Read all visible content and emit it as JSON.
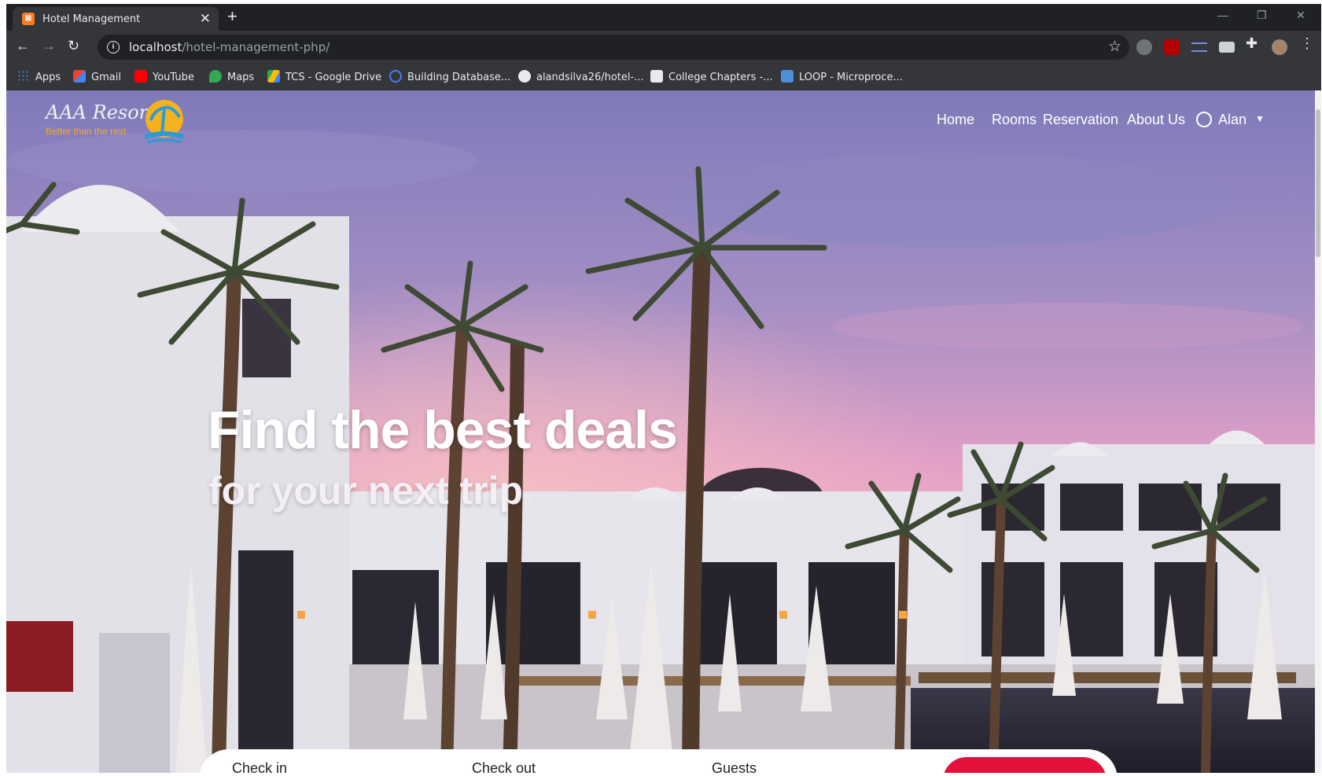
{
  "browser": {
    "tab_title": "Hotel Management",
    "tab_close": "✕",
    "new_tab": "+",
    "url_host": "localhost",
    "url_path": "/hotel-management-php/",
    "bookmarks": [
      {
        "label": "Apps",
        "icon": "apps-grid-icon",
        "color": "#4285f4"
      },
      {
        "label": "Gmail",
        "icon": "gmail-icon",
        "color": "#ea4335"
      },
      {
        "label": "YouTube",
        "icon": "youtube-icon",
        "color": "#ff0000"
      },
      {
        "label": "Maps",
        "icon": "maps-pin-icon",
        "color": "#34a853"
      },
      {
        "label": "TCS - Google Drive",
        "icon": "google-drive-icon",
        "color": "#fbbc04"
      },
      {
        "label": "Building Database...",
        "icon": "infinity-icon",
        "color": "#4a7df0"
      },
      {
        "label": "alandsilva26/hotel-...",
        "icon": "github-icon",
        "color": "#e8eaed"
      },
      {
        "label": "College Chapters -...",
        "icon": "cc-icon",
        "color": "#e8eaed"
      },
      {
        "label": "LOOP - Microproce...",
        "icon": "loop-icon",
        "color": "#4a90d9"
      }
    ]
  },
  "site": {
    "logo_title": "AAA Resorts",
    "logo_subtitle": "Better than the rest",
    "nav": [
      {
        "label": "Home"
      },
      {
        "label": "Rooms"
      },
      {
        "label": "Reservation"
      },
      {
        "label": "About Us"
      }
    ],
    "user_name": "Alan",
    "hero_title": "Find the best deals",
    "hero_subtitle": "for your next trip",
    "booking": {
      "check_in_label": "Check in",
      "check_out_label": "Check out",
      "guests_label": "Guests"
    }
  },
  "colors": {
    "accent_red": "#e6103c",
    "logo_orange": "#f2a634",
    "sky_top": "#7d77b7",
    "sky_pink": "#e4a1c6"
  }
}
